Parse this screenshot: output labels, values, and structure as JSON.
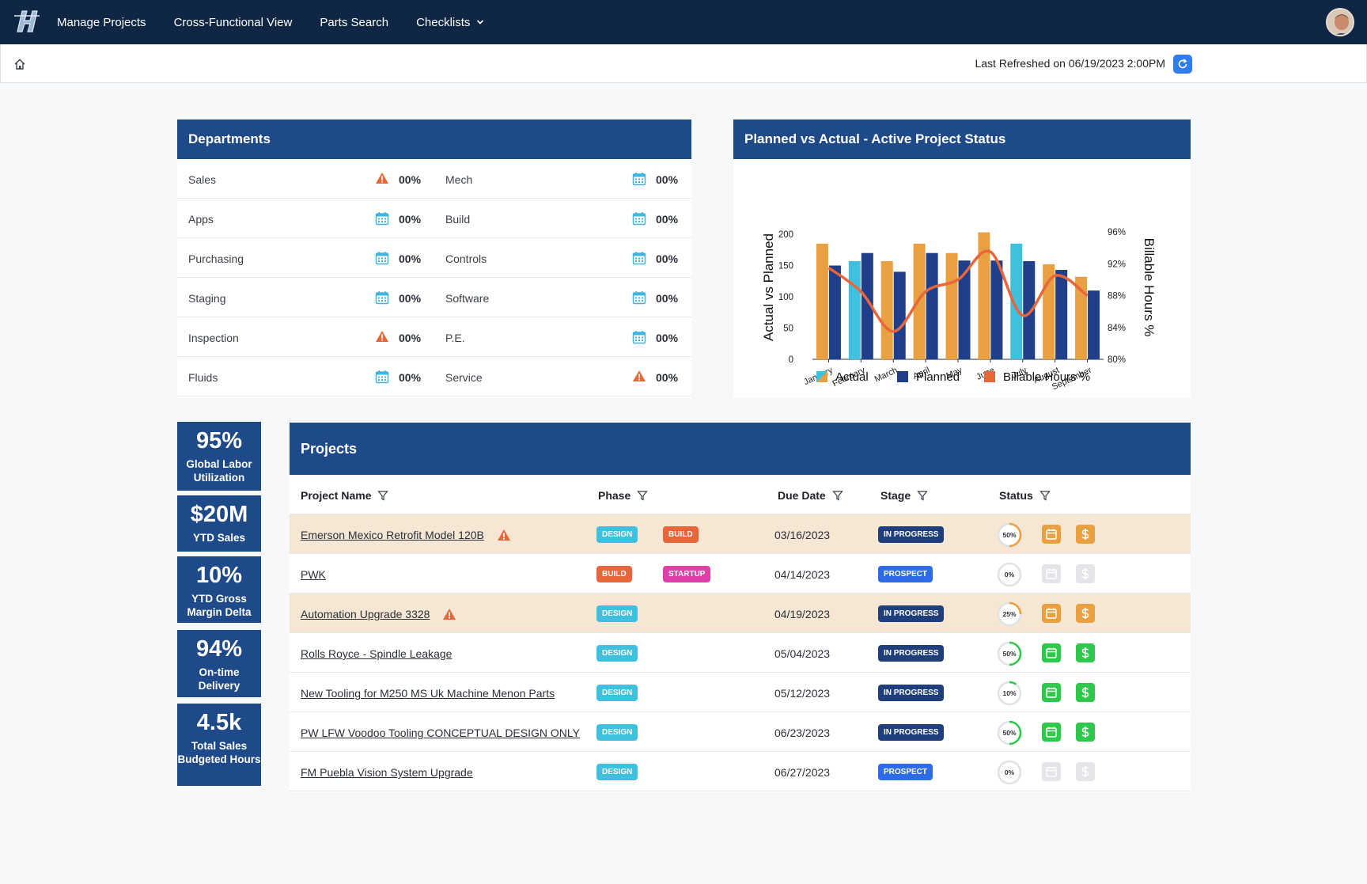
{
  "nav": {
    "items": [
      "Manage Projects",
      "Cross-Functional View",
      "Parts Search",
      "Checklists"
    ]
  },
  "header": {
    "refresh_text": "Last Refreshed on 06/19/2023 2:00PM"
  },
  "departments": {
    "title": "Departments",
    "rows": [
      {
        "left": {
          "name": "Sales",
          "icon": "warning-icon",
          "pct": "00%"
        },
        "right": {
          "name": "Mech",
          "icon": "calendar-icon",
          "pct": "00%"
        }
      },
      {
        "left": {
          "name": "Apps",
          "icon": "calendar-icon",
          "pct": "00%"
        },
        "right": {
          "name": "Build",
          "icon": "calendar-icon",
          "pct": "00%"
        }
      },
      {
        "left": {
          "name": "Purchasing",
          "icon": "calendar-icon",
          "pct": "00%"
        },
        "right": {
          "name": "Controls",
          "icon": "calendar-icon",
          "pct": "00%"
        }
      },
      {
        "left": {
          "name": "Staging",
          "icon": "calendar-icon",
          "pct": "00%"
        },
        "right": {
          "name": "Software",
          "icon": "calendar-icon",
          "pct": "00%"
        }
      },
      {
        "left": {
          "name": "Inspection",
          "icon": "warning-icon",
          "pct": "00%"
        },
        "right": {
          "name": "P.E.",
          "icon": "calendar-icon",
          "pct": "00%"
        }
      },
      {
        "left": {
          "name": "Fluids",
          "icon": "calendar-icon",
          "pct": "00%"
        },
        "right": {
          "name": "Service",
          "icon": "warning-icon",
          "pct": "00%"
        }
      }
    ]
  },
  "chart_panel": {
    "title": "Planned vs Actual - Active Project Status"
  },
  "chart_data": {
    "type": "bar",
    "categories": [
      "January",
      "February",
      "March",
      "April",
      "May",
      "June",
      "July",
      "August",
      "September"
    ],
    "series": [
      {
        "name": "Actual",
        "values": [
          185,
          157,
          157,
          185,
          170,
          203,
          185,
          152,
          132
        ]
      },
      {
        "name": "Planned",
        "values": [
          150,
          170,
          140,
          170,
          158,
          158,
          157,
          143,
          110
        ]
      },
      {
        "name": "Billable Hours %",
        "axis": "right",
        "values": [
          91.5,
          88.5,
          83.5,
          88.5,
          90,
          93.5,
          85.5,
          90.5,
          88
        ]
      }
    ],
    "ylabel": "Actual vs Planned",
    "y2label": "Billable Hours %",
    "ylim": [
      0,
      200
    ],
    "yticks": [
      "0",
      "50",
      "100",
      "150",
      "200"
    ],
    "y2lim": [
      80,
      96
    ],
    "y2ticks": [
      "80%",
      "84%",
      "88%",
      "92%",
      "96%"
    ],
    "legend": [
      "Actual",
      "Planned",
      "Billable Hours %"
    ],
    "legend_position": "bottom",
    "colors": {
      "actual": "#e8a040",
      "actual_highlight": "#3fc0df",
      "planned": "#1f3f8a",
      "line": "#e8663a"
    }
  },
  "kpis": [
    {
      "value": "95%",
      "label": "Global Labor Utilization"
    },
    {
      "value": "$20M",
      "label": "YTD Sales"
    },
    {
      "value": "10%",
      "label": "YTD Gross Margin Delta"
    },
    {
      "value": "94%",
      "label": "On-time Delivery"
    },
    {
      "value": "4.5k",
      "label": "Total Sales Budgeted Hours"
    }
  ],
  "projects": {
    "title": "Projects",
    "columns": [
      "Project Name",
      "Phase",
      "Due Date",
      "Stage",
      "Status"
    ],
    "rows": [
      {
        "name": "Emerson Mexico Retrofit  Model 120B",
        "warn": true,
        "highlight": true,
        "phases": [
          "DESIGN",
          "BUILD"
        ],
        "due": "03/16/2023",
        "stage": "IN PROGRESS",
        "progress_label": "50%",
        "progress": 0.5,
        "status_color": "orange"
      },
      {
        "name": "PWK",
        "warn": false,
        "highlight": false,
        "phases": [
          "BUILD",
          "STARTUP"
        ],
        "due": "04/14/2023",
        "stage": "PROSPECT",
        "progress_label": "0%",
        "progress": 0,
        "status_color": "gray"
      },
      {
        "name": "Automation Upgrade 3328",
        "warn": true,
        "highlight": true,
        "phases": [
          "DESIGN"
        ],
        "due": "04/19/2023",
        "stage": "IN PROGRESS",
        "progress_label": "25%",
        "progress": 0.25,
        "status_color": "orange"
      },
      {
        "name": "Rolls Royce - Spindle Leakage",
        "warn": false,
        "highlight": false,
        "phases": [
          "DESIGN"
        ],
        "due": "05/04/2023",
        "stage": "IN PROGRESS",
        "progress_label": "50%",
        "progress": 0.5,
        "status_color": "green"
      },
      {
        "name": "New Tooling for M250 MS Uk Machine Menon Parts",
        "warn": false,
        "highlight": false,
        "phases": [
          "DESIGN"
        ],
        "due": "05/12/2023",
        "stage": "IN PROGRESS",
        "progress_label": "10%",
        "progress": 0.1,
        "status_color": "green"
      },
      {
        "name": "PW LFW Voodoo Tooling CONCEPTUAL DESIGN ONLY",
        "warn": false,
        "highlight": false,
        "phases": [
          "DESIGN"
        ],
        "due": "06/23/2023",
        "stage": "IN PROGRESS",
        "progress_label": "50%",
        "progress": 0.5,
        "status_color": "green"
      },
      {
        "name": "FM Puebla Vision System Upgrade",
        "warn": false,
        "highlight": false,
        "phases": [
          "DESIGN"
        ],
        "due": "06/27/2023",
        "stage": "PROSPECT",
        "progress_label": "0%",
        "progress": 0,
        "status_color": "gray"
      }
    ]
  }
}
